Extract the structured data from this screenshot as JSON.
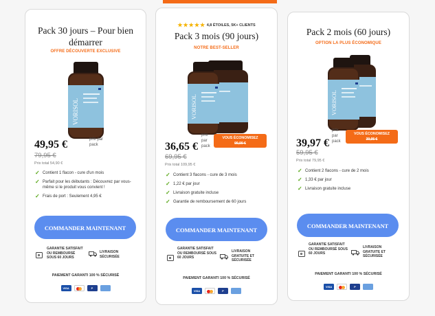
{
  "top_accent": "#f46b17",
  "cards": [
    {
      "title": "Pack 30 jours – Pour bien démarrer",
      "subtitle": "OFFRE DÉCOUVERTE EXCLUSIVE",
      "price": "49,95 €",
      "per_label": "prix par pack",
      "old_price": "79,95 €",
      "total": "Prix total 54,90 €",
      "bottle_count": 1,
      "features": [
        "Contient 1 flacon - cure d'un mois",
        "Parfait pour les débutants : Découvrez par vous-même si le produit vous convient !",
        "Frais de port : Seulement 4,95 €"
      ],
      "cta": "COMMANDER MAINTENANT",
      "guarantee": "GARANTIE SATISFAIT OU REMBOURSÉ SOUS 60 JOURS",
      "delivery": "LIVRAISON SÉCURISÉE",
      "payment": "PAIEMENT GARANTI 100 % SÉCURISÉ"
    },
    {
      "rating": "4,8 ÉTOILES, 5K+ CLIENTS",
      "stars": "★★★★★",
      "title": "Pack 3 mois (90 jours)",
      "subtitle": "NOTRE BEST-SELLER",
      "price": "36,65 €",
      "per_label": "prix par pack",
      "save_label": "VOUS ÉCONOMISEZ",
      "save_amount": "99,90 €",
      "old_price": "69,95 €",
      "total": "Prix total 109,95 €",
      "bottle_count": 3,
      "features": [
        "Contient 3 flacons - cure de 3 mois",
        "1,22 € par jour",
        "Livraison gratuite incluse",
        "Garantie de remboursement de 60 jours"
      ],
      "cta": "COMMANDER MAINTENANT",
      "guarantee": "GARANTIE SATISFAIT OU REMBOURSÉ SOUS 60 JOURS",
      "delivery": "LIVRAISON GRATUITE ET SÉCURISÉE",
      "payment": "PAIEMENT GARANTI 100 % SÉCURISÉ"
    },
    {
      "title": "Pack 2 mois (60 jours)",
      "subtitle": "OPTION LA PLUS ÉCONOMIQUE",
      "price": "39,97 €",
      "per_label": "prix par pack",
      "save_label": "VOUS ÉCONOMISEZ",
      "save_amount": "39,95 €",
      "old_price": "59,95 €",
      "total": "Prix total 79,95 €",
      "bottle_count": 2,
      "features": [
        "Contient 2 flacons - cure de 2 mois",
        "1,33 € par jour",
        "Livraison gratuite incluse"
      ],
      "cta": "COMMANDER MAINTENANT",
      "guarantee": "GARANTIE SATISFAIT OU REMBOURSÉ SOUS 60 JOURS",
      "delivery": "LIVRAISON GRATUITE ET SÉCURISÉE",
      "payment": "PAIEMENT GARANTI 100 % SÉCURISÉ"
    }
  ],
  "payment_methods": [
    "VISA",
    "Mastercard",
    "PayPal",
    "AMEX"
  ],
  "product_brand": "VORISOL"
}
